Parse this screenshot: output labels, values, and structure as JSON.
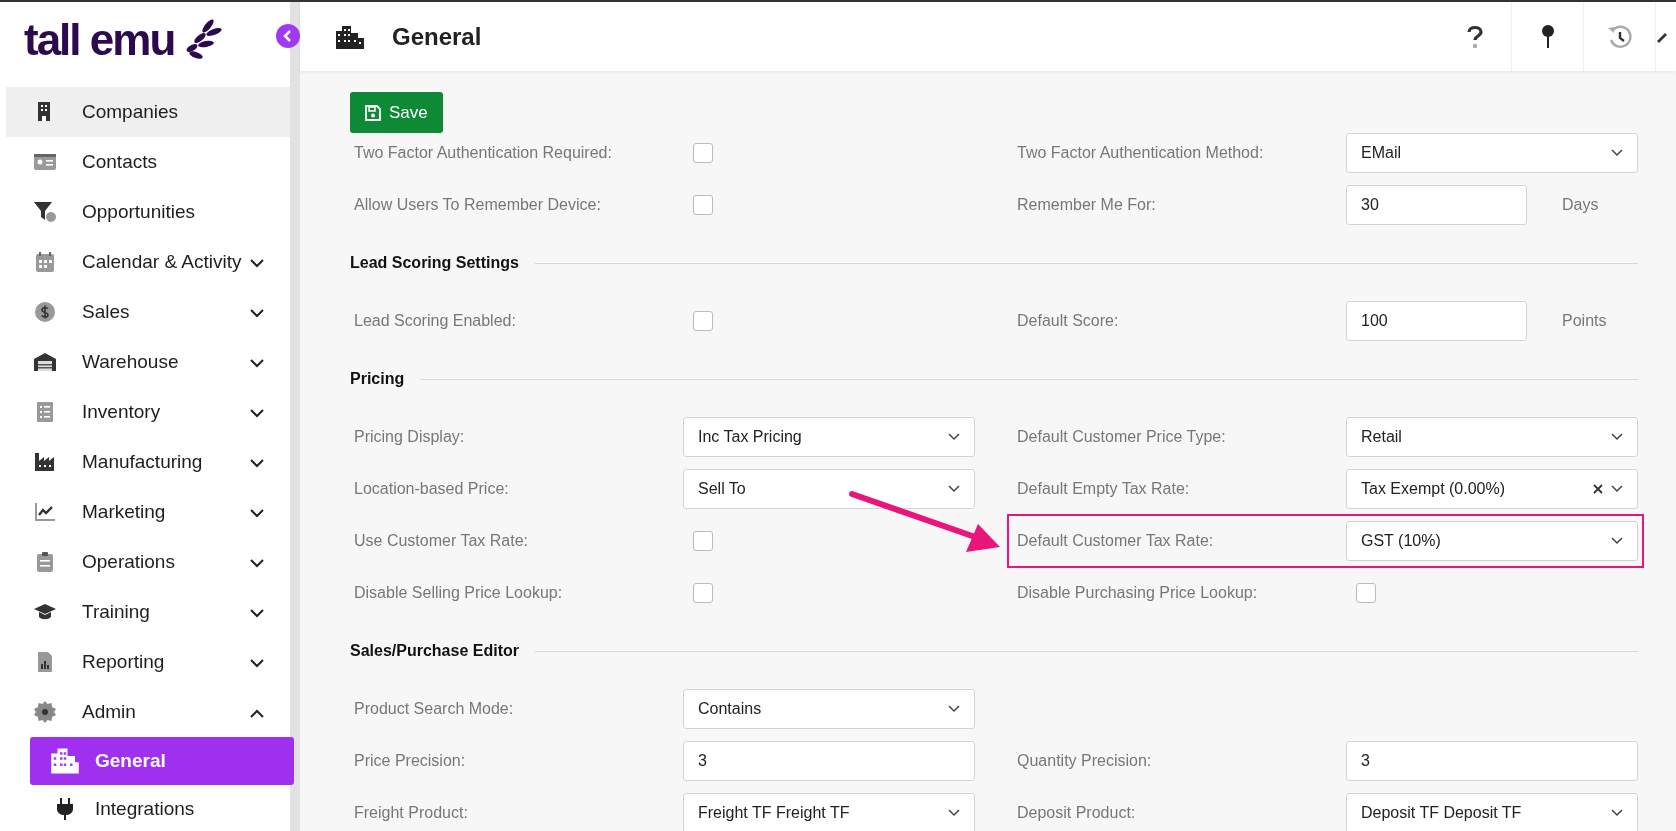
{
  "logo": {
    "text": "tall emu"
  },
  "sidebar": {
    "items": [
      {
        "label": "Companies",
        "kind": "link",
        "hovered": true,
        "selected": false
      },
      {
        "label": "Contacts",
        "kind": "link",
        "hovered": false,
        "selected": false
      },
      {
        "label": "Opportunities",
        "kind": "link",
        "hovered": false,
        "selected": false
      },
      {
        "label": "Calendar & Activity",
        "kind": "group",
        "expanded": false,
        "hovered": false,
        "selected": false
      },
      {
        "label": "Sales",
        "kind": "group",
        "expanded": false,
        "hovered": false,
        "selected": false
      },
      {
        "label": "Warehouse",
        "kind": "group",
        "expanded": false,
        "hovered": false,
        "selected": false
      },
      {
        "label": "Inventory",
        "kind": "group",
        "expanded": false,
        "hovered": false,
        "selected": false
      },
      {
        "label": "Manufacturing",
        "kind": "group",
        "expanded": false,
        "hovered": false,
        "selected": false
      },
      {
        "label": "Marketing",
        "kind": "group",
        "expanded": false,
        "hovered": false,
        "selected": false
      },
      {
        "label": "Operations",
        "kind": "group",
        "expanded": false,
        "hovered": false,
        "selected": false
      },
      {
        "label": "Training",
        "kind": "group",
        "expanded": false,
        "hovered": false,
        "selected": false
      },
      {
        "label": "Reporting",
        "kind": "group",
        "expanded": false,
        "hovered": false,
        "selected": false
      },
      {
        "label": "Admin",
        "kind": "group",
        "expanded": true,
        "hovered": false,
        "selected": false,
        "children": [
          {
            "label": "General",
            "hovered": false,
            "selected": true
          },
          {
            "label": "Integrations",
            "hovered": false,
            "selected": false
          }
        ]
      }
    ]
  },
  "header": {
    "title": "General"
  },
  "toolbar": {
    "save_label": "Save"
  },
  "sections": [
    {
      "rows": [
        [
          {
            "label": "Two Factor Authentication Required:",
            "kind": "checkbox",
            "checked": false
          },
          {
            "label": "Two Factor Authentication Method:",
            "kind": "select",
            "value": "EMail"
          }
        ],
        [
          {
            "label": "Allow Users To Remember Device:",
            "kind": "checkbox",
            "checked": false
          },
          {
            "label": "Remember Me For:",
            "kind": "text",
            "value": "30",
            "unit": "Days"
          }
        ]
      ]
    },
    {
      "heading": "Lead Scoring Settings",
      "rows": [
        [
          {
            "label": "Lead Scoring Enabled:",
            "kind": "checkbox",
            "checked": false
          },
          {
            "label": "Default Score:",
            "kind": "text",
            "value": "100",
            "unit": "Points"
          }
        ]
      ]
    },
    {
      "heading": "Pricing",
      "rows": [
        [
          {
            "label": "Pricing Display:",
            "kind": "select",
            "value": "Inc Tax Pricing"
          },
          {
            "label": "Default Customer Price Type:",
            "kind": "select",
            "value": "Retail"
          }
        ],
        [
          {
            "label": "Location-based Price:",
            "kind": "select",
            "value": "Sell To"
          },
          {
            "label": "Default Empty Tax Rate:",
            "kind": "select",
            "value": "Tax Exempt (0.00%)",
            "clearable": true
          }
        ],
        [
          {
            "label": "Use Customer Tax Rate:",
            "kind": "checkbox",
            "checked": false
          },
          {
            "label": "Default Customer Tax Rate:",
            "kind": "select",
            "value": "GST (10%)",
            "highlighted": true
          }
        ],
        [
          {
            "label": "Disable Selling Price Lookup:",
            "kind": "checkbox",
            "checked": false
          },
          {
            "label": "Disable Purchasing Price Lookup:",
            "kind": "checkbox",
            "checked": false
          }
        ]
      ]
    },
    {
      "heading": "Sales/Purchase Editor",
      "rows": [
        [
          {
            "label": "Product Search Mode:",
            "kind": "select",
            "value": "Contains"
          }
        ],
        [
          {
            "label": "Price Precision:",
            "kind": "text",
            "value": "3"
          },
          {
            "label": "Quantity Precision:",
            "kind": "text",
            "value": "3"
          }
        ],
        [
          {
            "label": "Freight Product:",
            "kind": "select",
            "value": "Freight TF Freight TF"
          },
          {
            "label": "Deposit Product:",
            "kind": "select",
            "value": "Deposit TF Deposit TF"
          }
        ]
      ]
    }
  ]
}
